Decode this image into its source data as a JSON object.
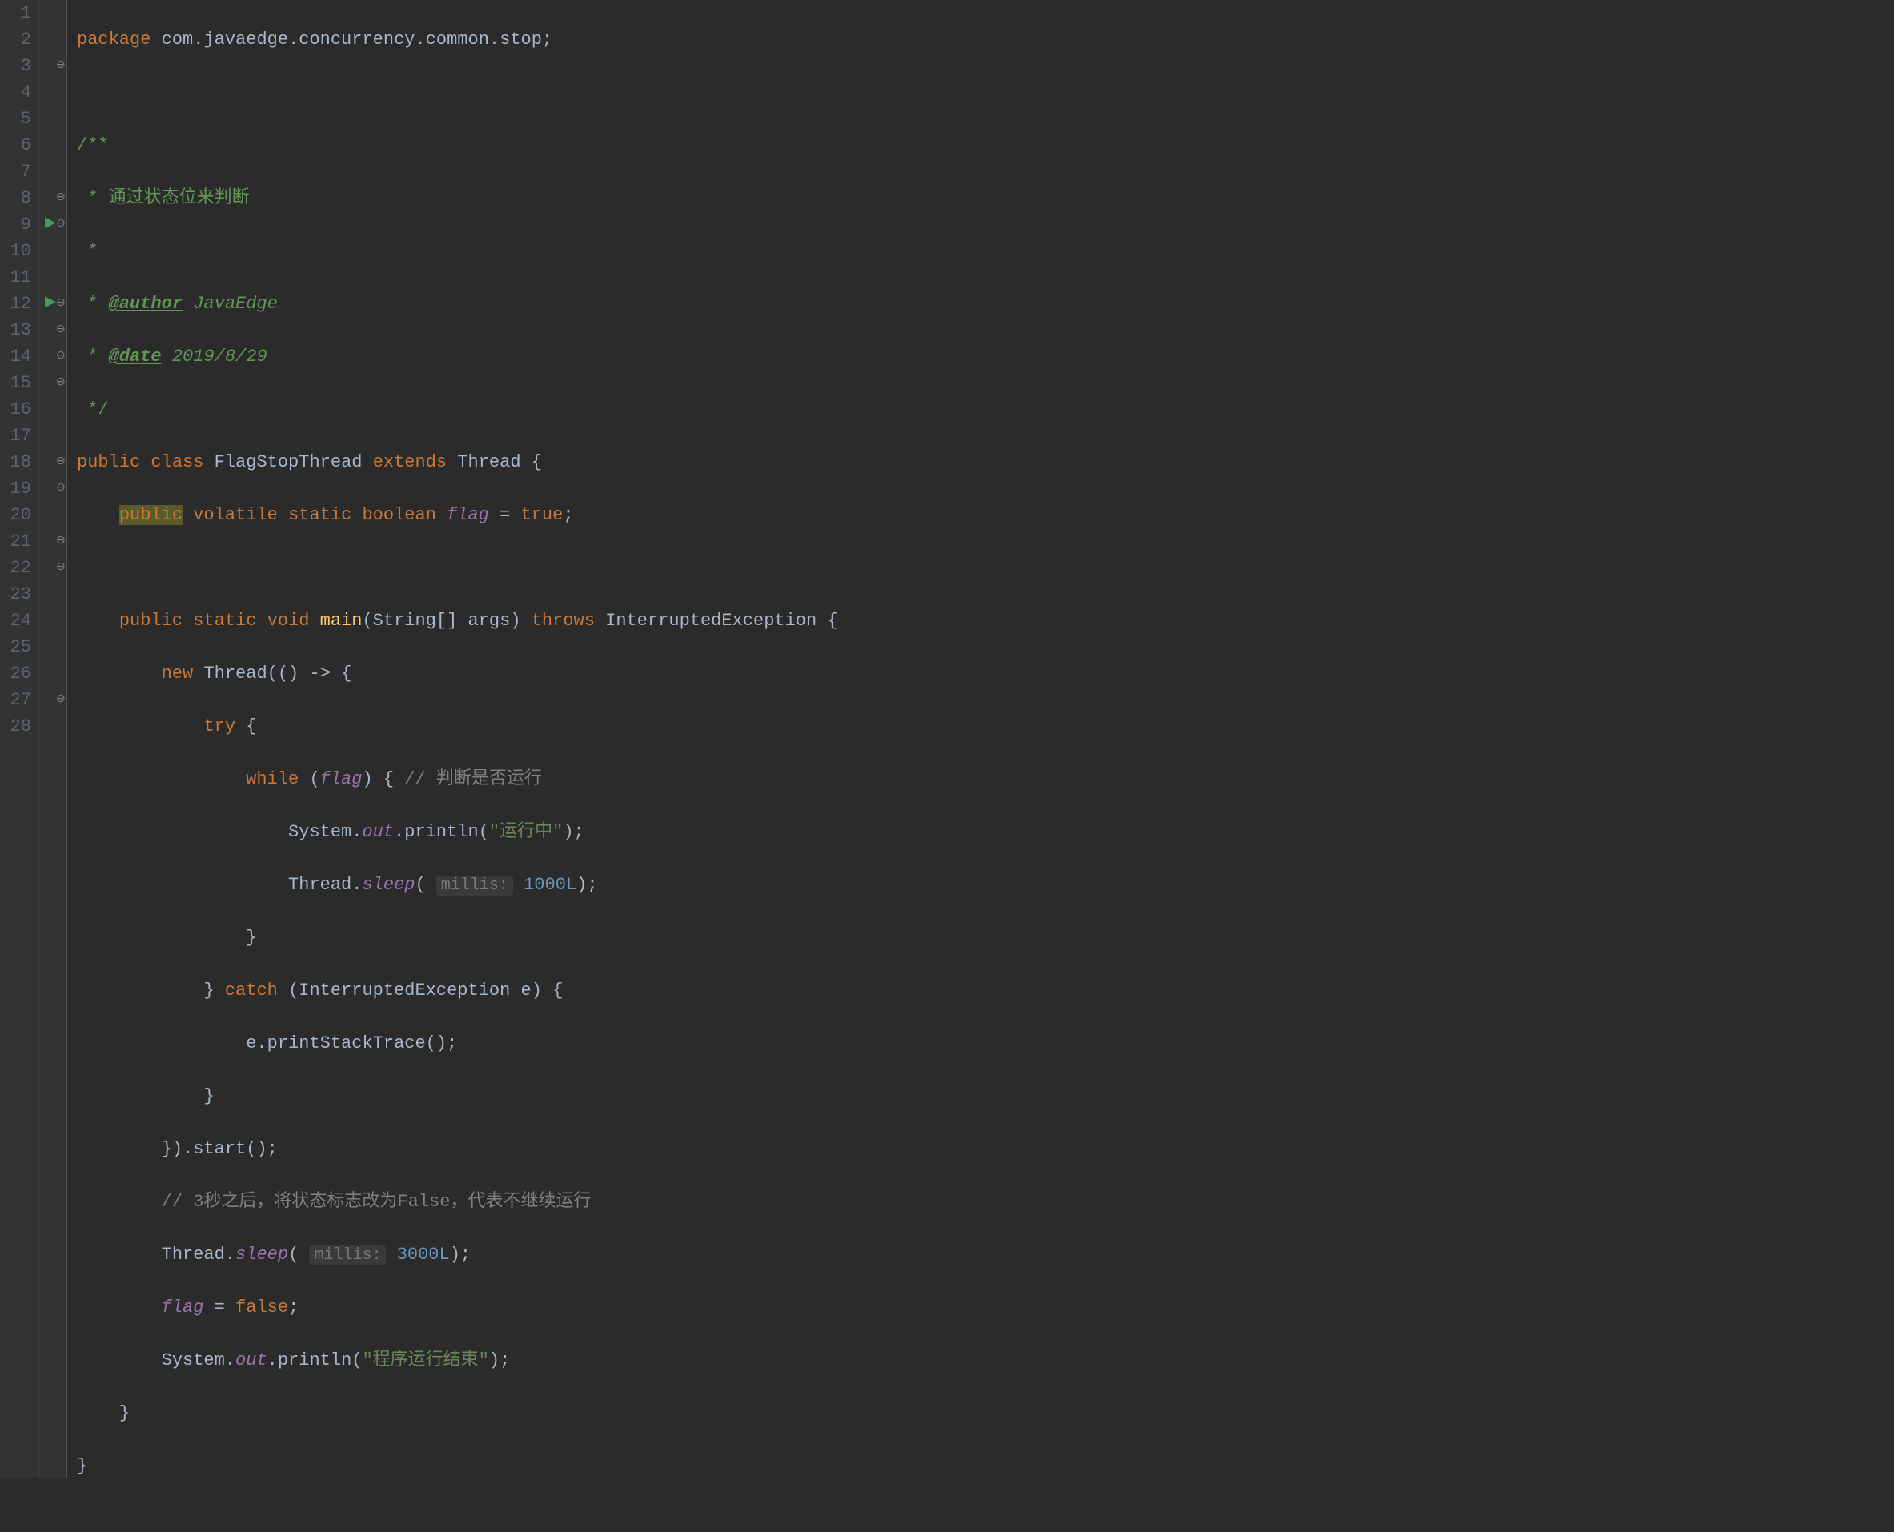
{
  "lines": {
    "l1_pkg": "package",
    "l1_path": "com.javaedge.concurrency.common.stop;",
    "l3": "/**",
    "l4": " * 通过状态位来判断",
    "l5": " *",
    "l6_star": " * ",
    "l6_tag": "@author",
    "l6_val": " JavaEdge",
    "l7_star": " * ",
    "l7_tag": "@date",
    "l7_val": " 2019/8/29",
    "l8": " */",
    "l9_public": "public",
    "l9_class": "class",
    "l9_name": "FlagStopThread",
    "l9_extends": "extends",
    "l9_thread": "Thread {",
    "l10_public": "public",
    "l10_volatile": "volatile",
    "l10_static": "static",
    "l10_boolean": "boolean",
    "l10_flag": "flag",
    "l10_eq": "=",
    "l10_true": "true",
    "l10_semi": ";",
    "l12_public": "public",
    "l12_static": "static",
    "l12_void": "void",
    "l12_main": "main",
    "l12_params": "(String[] args)",
    "l12_throws": "throws",
    "l12_exc": "InterruptedException {",
    "l13_new": "new",
    "l13_thread": "Thread(() -> {",
    "l14_try": "try",
    "l14_brace": "{",
    "l15_while": "while",
    "l15_open": "(",
    "l15_flag": "flag",
    "l15_close": ") {",
    "l15_comment": "// 判断是否运行",
    "l16_sys": "System.",
    "l16_out": "out",
    "l16_print": ".println(",
    "l16_str": "\"运行中\"",
    "l16_end": ");",
    "l17_thread": "Thread.",
    "l17_sleep": "sleep",
    "l17_open": "(",
    "l17_hint": "millis:",
    "l17_num": "1000L",
    "l17_end": ");",
    "l18": "}",
    "l19_close": "}",
    "l19_catch": "catch",
    "l19_params": "(InterruptedException e) {",
    "l20": "e.printStackTrace();",
    "l21": "}",
    "l22": "}).start();",
    "l23": "// 3秒之后，将状态标志改为False，代表不继续运行",
    "l24_thread": "Thread.",
    "l24_sleep": "sleep",
    "l24_open": "(",
    "l24_hint": "millis:",
    "l24_num": "3000L",
    "l24_end": ");",
    "l25_flag": "flag",
    "l25_rest": " = ",
    "l25_false": "false",
    "l25_semi": ";",
    "l26_sys": "System.",
    "l26_out": "out",
    "l26_print": ".println(",
    "l26_str": "\"程序运行结束\"",
    "l26_end": ");",
    "l27": "}",
    "l28": "}"
  },
  "lineNumbers": [
    "1",
    "2",
    "3",
    "4",
    "5",
    "6",
    "7",
    "8",
    "9",
    "10",
    "11",
    "12",
    "13",
    "14",
    "15",
    "16",
    "17",
    "18",
    "19",
    "20",
    "21",
    "22",
    "23",
    "24",
    "25",
    "26",
    "27",
    "28"
  ]
}
